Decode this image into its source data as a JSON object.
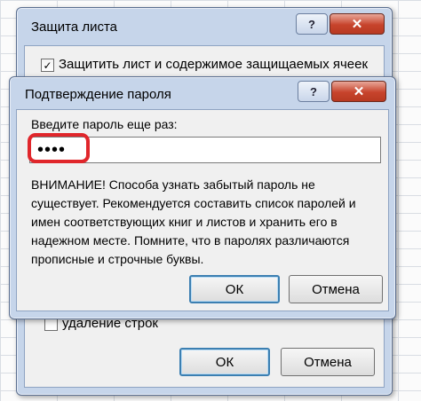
{
  "back_dialog": {
    "title": "Защита листа",
    "help_button": "?",
    "close_button": "✕",
    "checkbox_protect_label": "Защитить лист и содержимое защищаемых ячеек",
    "checkbox_protect_checked": "✓",
    "checkbox_delete_rows_label": "удаление строк",
    "ok_label": "ОК",
    "cancel_label": "Отмена"
  },
  "front_dialog": {
    "title": "Подтверждение пароля",
    "help_button": "?",
    "close_button": "✕",
    "prompt_label": "Введите пароль еще раз:",
    "password_value": "••••",
    "warning_text": "ВНИМАНИЕ! Способа узнать забытый пароль не существует. Рекомендуется составить список паролей и имен соответствующих книг и листов и хранить его в надежном месте. Помните, что в паролях различаются прописные и строчные буквы.",
    "ok_label": "ОК",
    "cancel_label": "Отмена"
  },
  "colors": {
    "highlight_red": "#e0262b",
    "titlebar_blue": "#c6d5ea"
  }
}
